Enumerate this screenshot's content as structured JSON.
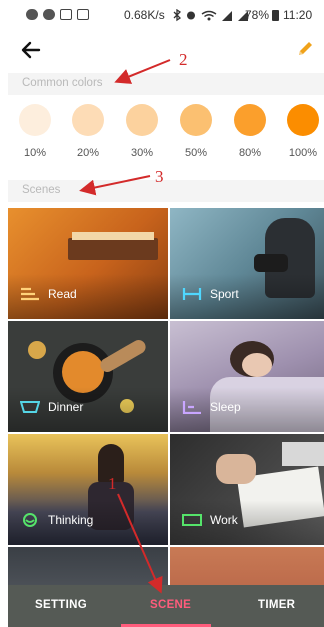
{
  "status_bar": {
    "speed": "0.68K/s",
    "battery": "78%",
    "time": "11:20"
  },
  "header": {
    "back_icon": "back-arrow-icon",
    "edit_icon": "pencil-icon"
  },
  "sections": {
    "common_colors": "Common colors",
    "scenes": "Scenes"
  },
  "colors": [
    {
      "label": "10%",
      "hex": "#fdeedd"
    },
    {
      "label": "20%",
      "hex": "#fddcb6"
    },
    {
      "label": "30%",
      "hex": "#fcd29e"
    },
    {
      "label": "50%",
      "hex": "#fbc071"
    },
    {
      "label": "80%",
      "hex": "#fb9f2c"
    },
    {
      "label": "100%",
      "hex": "#fb8d00"
    }
  ],
  "scenes": [
    {
      "label": "Read",
      "icon": "read-icon"
    },
    {
      "label": "Sport",
      "icon": "dumbbell-icon"
    },
    {
      "label": "Dinner",
      "icon": "bowl-icon"
    },
    {
      "label": "Sleep",
      "icon": "sleep-icon"
    },
    {
      "label": "Thinking",
      "icon": "smile-icon"
    },
    {
      "label": "Work",
      "icon": "work-icon"
    },
    {
      "label": "",
      "icon": ""
    },
    {
      "label": "",
      "icon": ""
    }
  ],
  "tabs": {
    "setting": "SETTING",
    "scene": "SCENE",
    "timer": "TIMER"
  },
  "annotations": {
    "n1": "1",
    "n2": "2",
    "n3": "3"
  },
  "accent_color": "#ff5c7c"
}
